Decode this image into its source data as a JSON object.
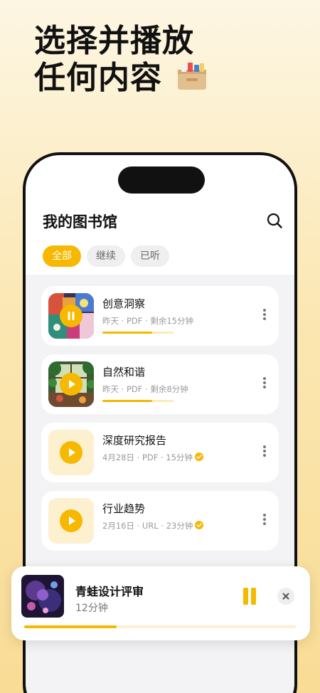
{
  "promo": {
    "headline_line1": "选择并播放",
    "headline_line2": "任何内容",
    "decoration_icon": "file-box-icon"
  },
  "colors": {
    "accent": "#f6b800",
    "accent_light": "#fdf0cf",
    "background_top": "#fdf6e3",
    "background_bottom": "#f9dc95"
  },
  "library": {
    "title": "我的图书馆",
    "search_icon": "search-icon",
    "filters": [
      {
        "label": "全部",
        "active": true
      },
      {
        "label": "继续",
        "active": false
      },
      {
        "label": "已听",
        "active": false
      }
    ],
    "items": [
      {
        "title": "创意洞察",
        "meta": "昨天 · PDF · 剩余15分钟",
        "state": "playing",
        "thumb": "abstract-painting",
        "progress": 0.7,
        "icon": "pause-icon"
      },
      {
        "title": "自然和谐",
        "meta": "昨天 · PDF · 剩余8分钟",
        "state": "paused",
        "thumb": "forest-window-painting",
        "progress": 0.7,
        "icon": "play-icon"
      },
      {
        "title": "深度研究报告",
        "meta": "4月28日 · PDF · 15分钟",
        "state": "finished",
        "thumb": "plain",
        "icon": "play-icon"
      },
      {
        "title": "行业趋势",
        "meta": "2月16日 · URL · 23分钟",
        "state": "finished",
        "thumb": "plain",
        "icon": "play-icon"
      }
    ]
  },
  "player": {
    "title": "青蛙设计评审",
    "subtitle": "12分钟",
    "progress": 0.34,
    "pause_icon": "pause-icon",
    "close_icon": "close-icon"
  }
}
